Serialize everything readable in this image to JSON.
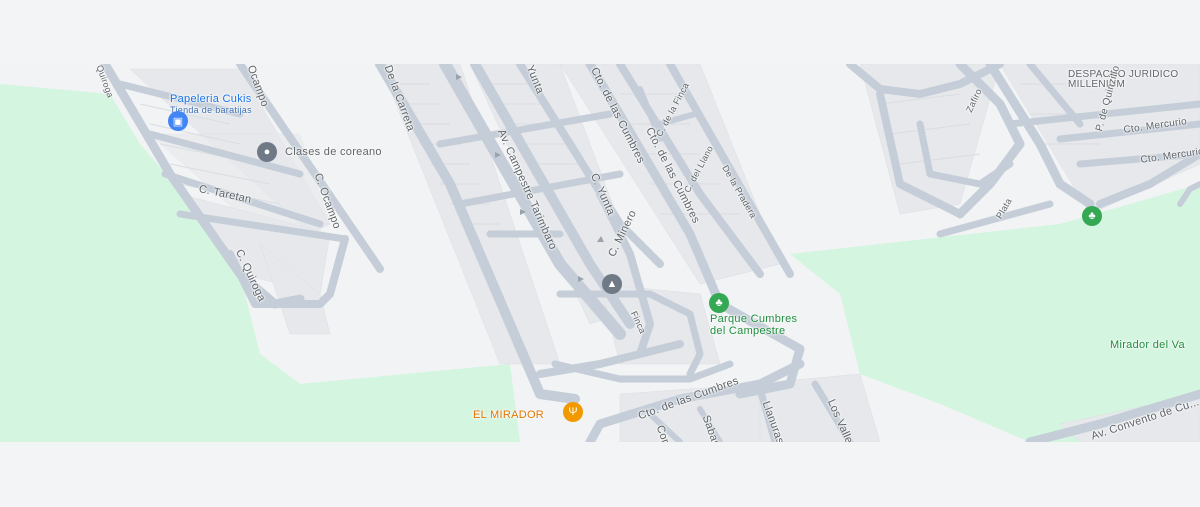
{
  "map": {
    "streets": [
      "Ocampo",
      "C. Ocampo",
      "C. Taretan",
      "C. Quiroga",
      "Quiroga",
      "De la Carreta",
      "Yunta",
      "Av. Campestre Tarimbaro",
      "C. Yunta",
      "C. Minero",
      "Cto. de las Cumbres",
      "Cto. de las Cumbres",
      "C. de la Finca",
      "C. del Llano",
      "De la Pradera",
      "Finca",
      "Cto. de las Cumbres",
      "Sabana",
      "Cor...",
      "Llanuras",
      "Los Valles",
      "Zafiro",
      "P. de Quinzillo",
      "Cto. Mercurio",
      "Cto. Mercurio",
      "Plata",
      "Av. Convento de Cu...",
      "DESPACHO JURIDICO MILLENIUM"
    ],
    "pois": {
      "papeleria_name": "Papeleria Cukis",
      "papeleria_sub": "Tienda de baratijas",
      "clases": "Clases de coreano",
      "parque_line1": "Parque Cumbres",
      "parque_line2": "del Campestre",
      "mirador_valle": "Mirador del Va",
      "el_mirador": "EL MIRADOR",
      "despacho_line1": "DESPACHO JURIDICO",
      "despacho_line2": "MILLENIUM"
    },
    "colors": {
      "park": "#d4f5e0",
      "road": "#c5ced8",
      "building": "#e4e6e9",
      "land": "#f1f3f4"
    }
  }
}
